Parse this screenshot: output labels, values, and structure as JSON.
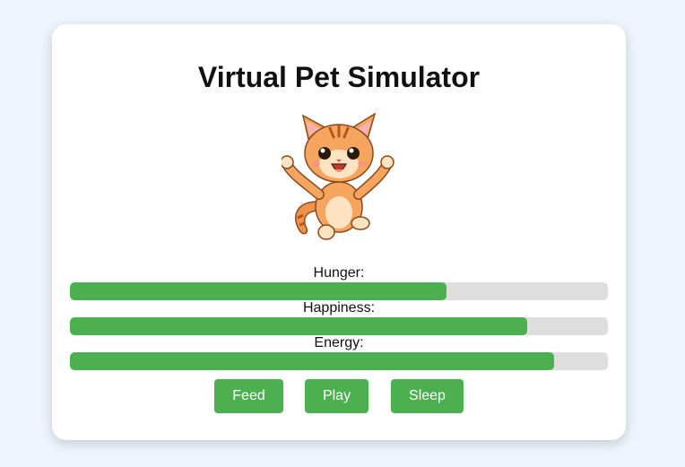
{
  "title": "Virtual Pet Simulator",
  "pet": {
    "icon": "orange-kitten-icon"
  },
  "stats": [
    {
      "label": "Hunger:",
      "level": 0.7
    },
    {
      "label": "Happiness:",
      "level": 0.85
    },
    {
      "label": "Energy:",
      "level": 0.9
    }
  ],
  "actions": {
    "feed": "Feed",
    "play": "Play",
    "sleep": "Sleep"
  },
  "colors": {
    "bar_fill": "#4caf50",
    "bar_track": "#dedede",
    "button": "#4caf50",
    "page_bg": "#eef5fe"
  }
}
